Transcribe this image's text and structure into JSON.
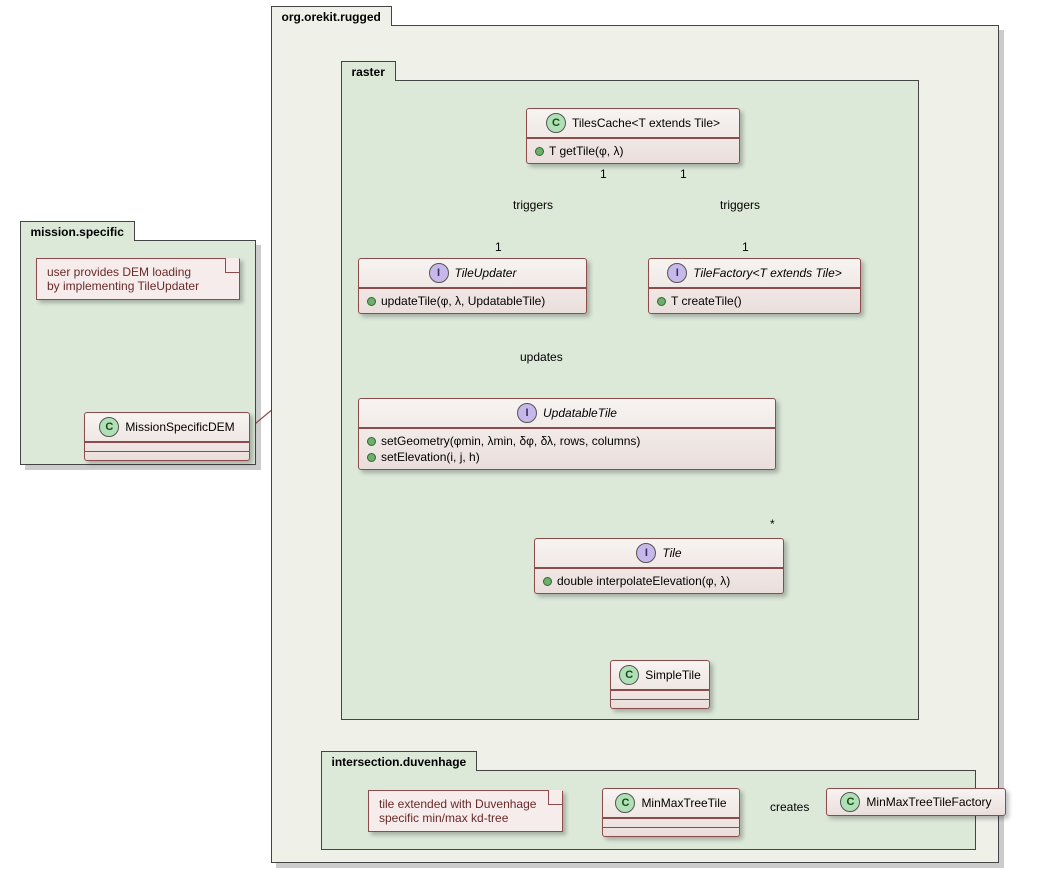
{
  "packages": {
    "outer": "org.orekit.rugged",
    "raster": "raster",
    "duvenhage": "intersection.duvenhage",
    "mission": "mission.specific"
  },
  "notes": {
    "dem_line1": "user provides DEM loading",
    "dem_line2": "by implementing TileUpdater",
    "tree_line1": "tile extended with Duvenhage",
    "tree_line2": "specific min/max kd-tree"
  },
  "classes": {
    "tilesCache": {
      "name": "TilesCache<T extends Tile>",
      "stereo": "C",
      "methods": [
        "T getTile(φ, λ)"
      ]
    },
    "tileUpdater": {
      "name": "TileUpdater",
      "stereo": "I",
      "methods": [
        "updateTile(φ, λ, UpdatableTile)"
      ]
    },
    "tileFactory": {
      "name": "TileFactory<T extends Tile>",
      "stereo": "I",
      "methods": [
        "T createTile()"
      ]
    },
    "updatableTile": {
      "name": "UpdatableTile",
      "stereo": "I",
      "methods": [
        "setGeometry(φmin, λmin, δφ, δλ, rows, columns)",
        "setElevation(i, j, h)"
      ]
    },
    "tile": {
      "name": "Tile",
      "stereo": "I",
      "methods": [
        "double interpolateElevation(φ, λ)"
      ]
    },
    "simpleTile": {
      "name": "SimpleTile",
      "stereo": "C",
      "methods": []
    },
    "missionDEM": {
      "name": "MissionSpecificDEM",
      "stereo": "C",
      "methods": []
    },
    "minMaxTile": {
      "name": "MinMaxTreeTile",
      "stereo": "C",
      "methods": []
    },
    "minMaxFactory": {
      "name": "MinMaxTreeTileFactory",
      "stereo": "C",
      "methods": []
    }
  },
  "relations": {
    "triggers1": "triggers",
    "triggers2": "triggers",
    "updates": "updates",
    "creates": "creates",
    "m1a": "1",
    "m1b": "1",
    "m2a": "1",
    "m2b": "1",
    "mstar": "*"
  },
  "chart_data": {
    "type": "uml-class-diagram",
    "packages": [
      {
        "name": "org.orekit.rugged",
        "children": [
          "raster",
          "intersection.duvenhage"
        ]
      },
      {
        "name": "raster",
        "children": [
          "TilesCache",
          "TileUpdater",
          "TileFactory",
          "UpdatableTile",
          "Tile",
          "SimpleTile"
        ]
      },
      {
        "name": "intersection.duvenhage",
        "children": [
          "MinMaxTreeTile",
          "MinMaxTreeTileFactory"
        ]
      },
      {
        "name": "mission.specific",
        "children": [
          "MissionSpecificDEM"
        ]
      }
    ],
    "classes": [
      {
        "name": "TilesCache<T extends Tile>",
        "kind": "class",
        "methods": [
          "T getTile(φ, λ)"
        ]
      },
      {
        "name": "TileUpdater",
        "kind": "interface",
        "methods": [
          "updateTile(φ, λ, UpdatableTile)"
        ]
      },
      {
        "name": "TileFactory<T extends Tile>",
        "kind": "interface",
        "methods": [
          "T createTile()"
        ]
      },
      {
        "name": "UpdatableTile",
        "kind": "interface",
        "methods": [
          "setGeometry(φmin, λmin, δφ, δλ, rows, columns)",
          "setElevation(i, j, h)"
        ]
      },
      {
        "name": "Tile",
        "kind": "interface",
        "methods": [
          "double interpolateElevation(φ, λ)"
        ]
      },
      {
        "name": "SimpleTile",
        "kind": "class",
        "methods": []
      },
      {
        "name": "MissionSpecificDEM",
        "kind": "class",
        "methods": []
      },
      {
        "name": "MinMaxTreeTile",
        "kind": "class",
        "methods": []
      },
      {
        "name": "MinMaxTreeTileFactory",
        "kind": "class",
        "methods": []
      }
    ],
    "relations": [
      {
        "from": "TilesCache",
        "to": "TileUpdater",
        "type": "association",
        "label": "triggers",
        "from_mult": "1",
        "to_mult": "1"
      },
      {
        "from": "TilesCache",
        "to": "TileFactory",
        "type": "association",
        "label": "triggers",
        "from_mult": "1",
        "to_mult": "1"
      },
      {
        "from": "TilesCache",
        "to": "Tile",
        "type": "aggregation",
        "to_mult": "*"
      },
      {
        "from": "TileUpdater",
        "to": "UpdatableTile",
        "type": "association",
        "label": "updates"
      },
      {
        "from": "Tile",
        "to": "UpdatableTile",
        "type": "realization"
      },
      {
        "from": "SimpleTile",
        "to": "Tile",
        "type": "realization"
      },
      {
        "from": "MissionSpecificDEM",
        "to": "TileUpdater",
        "type": "realization"
      },
      {
        "from": "MinMaxTreeTile",
        "to": "SimpleTile",
        "type": "generalization"
      },
      {
        "from": "MinMaxTreeTileFactory",
        "to": "TileFactory",
        "type": "realization"
      },
      {
        "from": "MinMaxTreeTileFactory",
        "to": "MinMaxTreeTile",
        "type": "association",
        "label": "creates"
      }
    ],
    "notes": [
      {
        "text": "user provides DEM loading by implementing TileUpdater",
        "attached_to": "MissionSpecificDEM"
      },
      {
        "text": "tile extended with Duvenhage specific min/max kd-tree",
        "attached_to": "MinMaxTreeTile"
      }
    ]
  }
}
